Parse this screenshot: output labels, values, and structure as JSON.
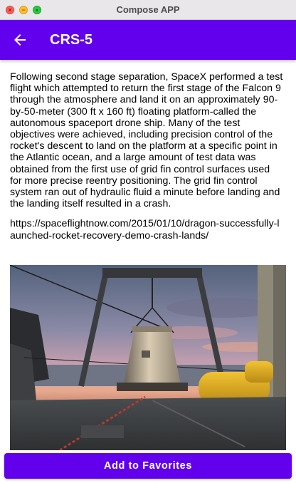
{
  "window": {
    "title": "Compose APP"
  },
  "colors": {
    "primary": "#6200ee",
    "on_primary": "#ffffff",
    "titlebar_bg": "#e9e7ea"
  },
  "appbar": {
    "back_icon": "arrow-back-icon",
    "title": "CRS-5"
  },
  "launch": {
    "details": "Following second stage separation, SpaceX performed a test flight which attempted to return the first stage of the Falcon 9 through the atmosphere and land it on an approximately 90-by-50-meter (300 ft x 160 ft) floating platform-called the autonomous spaceport drone ship. Many of the test objectives were achieved, including precision control of the rocket's descent to land on the platform at a specific point in the Atlantic ocean, and a large amount of test data was obtained from the first use of grid fin control surfaces used for more precise reentry positioning. The grid fin control system ran out of hydraulic fluid a minute before landing and the landing itself resulted in a crash.",
    "article_link": "https://spaceflightnow.com/2015/01/10/dragon-successfully-launched-rocket-recovery-demo-crash-lands/",
    "photo": "dragon-capsule-recovery-ship-photo"
  },
  "actions": {
    "favorite_label": "Add to Favorites"
  }
}
